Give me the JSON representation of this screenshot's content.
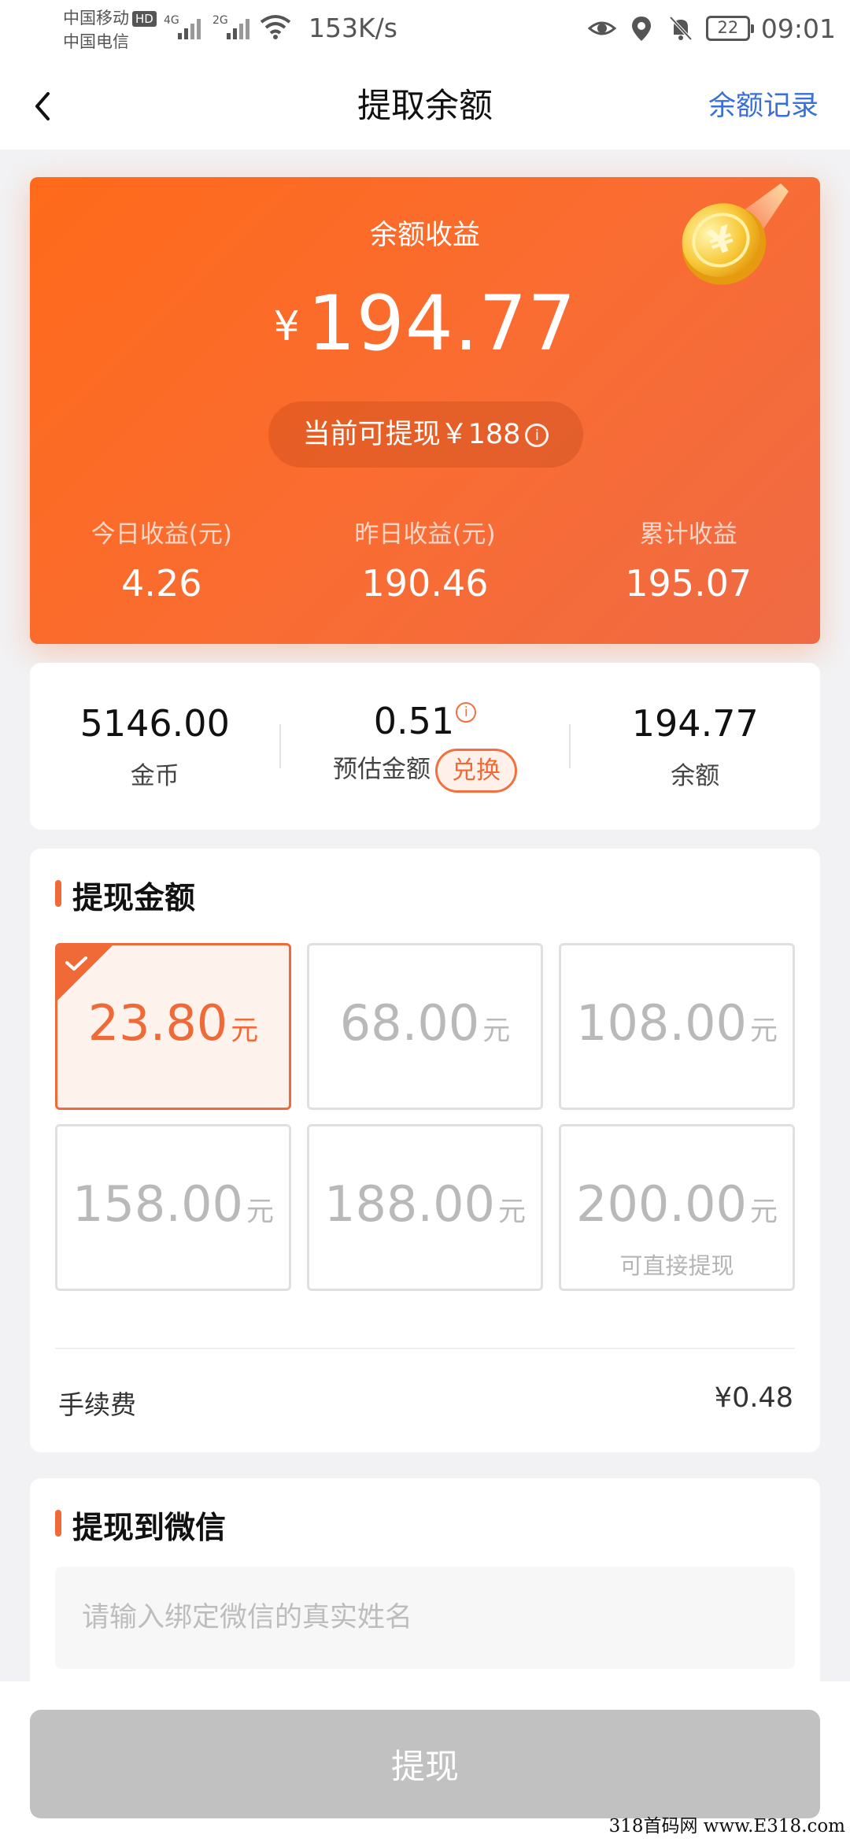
{
  "status_bar": {
    "carrier_1": "中国移动",
    "hd": "HD",
    "carrier_2": "中国电信",
    "sig_1": "4G",
    "sig_2": "2G",
    "speed": "153K/s",
    "battery": "22",
    "time": "09:01"
  },
  "nav": {
    "title": "提取余额",
    "right_link": "余额记录"
  },
  "balance": {
    "label": "余额收益",
    "currency": "¥",
    "amount": "194.77",
    "withdrawable": "当前可提现￥188",
    "info_glyph": "i",
    "stats": [
      {
        "label": "今日收益(元)",
        "value": "4.26"
      },
      {
        "label": "昨日收益(元)",
        "value": "190.46"
      },
      {
        "label": "累计收益",
        "value": "195.07"
      }
    ]
  },
  "summary": {
    "coins": {
      "value": "5146.00",
      "label": "金币"
    },
    "estimate": {
      "value": "0.51",
      "label": "预估金额",
      "info_glyph": "i",
      "exchange": "兑换"
    },
    "balance": {
      "value": "194.77",
      "label": "余额"
    }
  },
  "withdraw": {
    "title": "提现金额",
    "unit": "元",
    "options": [
      {
        "value": "23.80",
        "selected": true,
        "note": ""
      },
      {
        "value": "68.00",
        "selected": false,
        "note": ""
      },
      {
        "value": "108.00",
        "selected": false,
        "note": ""
      },
      {
        "value": "158.00",
        "selected": false,
        "note": ""
      },
      {
        "value": "188.00",
        "selected": false,
        "note": ""
      },
      {
        "value": "200.00",
        "selected": false,
        "note": "可直接提现"
      }
    ],
    "fee_label": "手续费",
    "fee_value": "¥0.48"
  },
  "wechat": {
    "title": "提现到微信",
    "name_value": "",
    "name_placeholder": "请输入绑定微信的真实姓名"
  },
  "submit_label": "提现",
  "watermark": "318首码网 www.E318.com",
  "colors": {
    "accent": "#f06a38",
    "card_gradient_start": "#ff6a1a",
    "card_gradient_end": "#ef6a44",
    "link": "#3a6fd8",
    "button_disabled": "#c1c1c1"
  },
  "icons": [
    "back-arrow-icon",
    "wifi-icon",
    "eye-icon",
    "location-icon",
    "bell-off-icon",
    "battery-icon",
    "coin-icon",
    "info-icon",
    "check-icon"
  ]
}
